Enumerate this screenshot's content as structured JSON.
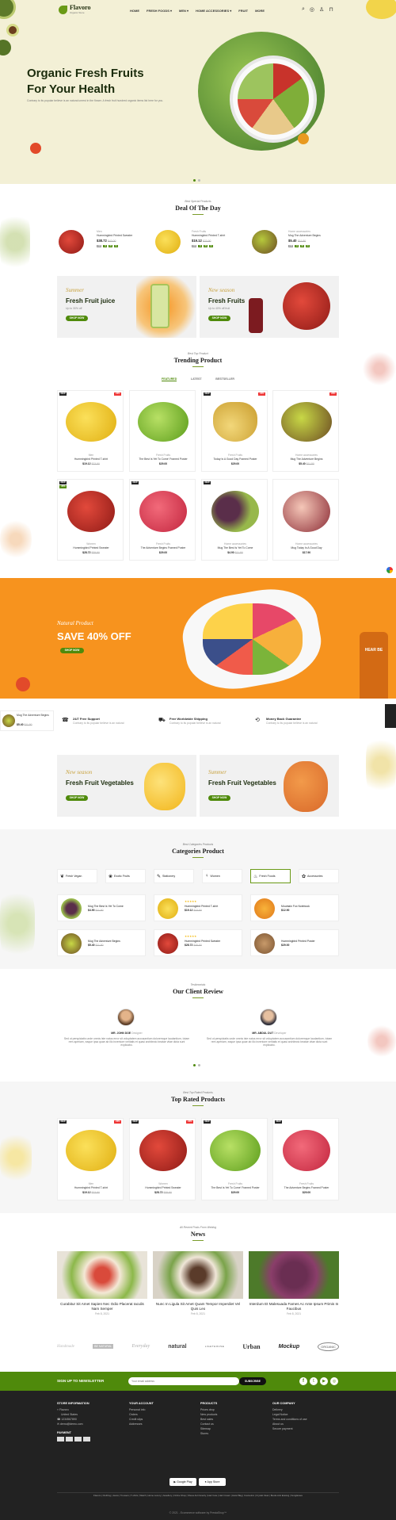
{
  "header": {
    "brand": "Flavoro",
    "brand_tagline": "Organic Store",
    "nav": [
      "HOME",
      "FRESH FOODS",
      "MEN",
      "HOME ACCESSORIES",
      "FRUIT",
      "MORE"
    ]
  },
  "hero": {
    "title_line1": "Organic Fresh Fruits",
    "title_line2": "For Your Health",
    "text": "Contrary to its popular believe is an natural unrest in the flower. A fresh fruit hundred organic items list here for you."
  },
  "deal": {
    "subtitle": "Best Special Products",
    "title": "Deal Of The Day",
    "items": [
      {
        "cat": "Men",
        "name": "Hummingbird Printed Sweater",
        "price": "$38.72",
        "old": "$43.00",
        "timer": [
          "249",
          "12",
          "05",
          "01"
        ]
      },
      {
        "cat": "Fresh Fruits",
        "name": "Hummingbird Printed T-shirt",
        "price": "$19.12",
        "old": "$23.90",
        "timer": [
          "249",
          "12",
          "05",
          "01"
        ]
      },
      {
        "cat": "Home accessories",
        "name": "Mug The Adventure Begins",
        "price": "$5.40",
        "old": "$11.90",
        "timer": [
          "249",
          "12",
          "05",
          "01"
        ]
      }
    ]
  },
  "promo1": [
    {
      "script": "Summer",
      "title": "Fresh Fruit juice",
      "text": "Up to 30% off",
      "btn": "SHOP NOW"
    },
    {
      "script": "New season",
      "title": "Fresh Fruits",
      "text": "Up to 40% off fruit",
      "btn": "SHOP NOW"
    }
  ],
  "trending": {
    "subtitle": "Best Top Product",
    "title": "Trending Product",
    "tabs": [
      "FEATURED",
      "LATEST",
      "BESTSELLER"
    ],
    "products": [
      {
        "cat": "Men",
        "name": "Hummingbird Printed T-shirt",
        "price": "$19.12",
        "old": "$23.90",
        "badge": "NEW",
        "sale": "-20%",
        "fruit": "lemon"
      },
      {
        "cat": "Fresh Fruits",
        "name": "The Best Is Yet To Come' Framed Poster",
        "price": "$29.00",
        "old": "",
        "badge": "",
        "sale": "",
        "fruit": "lime"
      },
      {
        "cat": "Fresh Fruits",
        "name": "Today Is A Good Day Framed Poster",
        "price": "$29.00",
        "old": "",
        "badge": "NEW",
        "sale": "-20%",
        "fruit": "pineapple"
      },
      {
        "cat": "Home accessories",
        "name": "Mug The Adventure Begins",
        "price": "$5.40",
        "old": "$11.90",
        "badge": "",
        "sale": "-20%",
        "fruit": "kiwi"
      },
      {
        "cat": "Women",
        "name": "Hummingbird Printed Sweater",
        "price": "$28.72",
        "old": "$35.90",
        "badge": "NEW",
        "sale": "-20%",
        "fruit": "pomegranate"
      },
      {
        "cat": "Fresh Fruits",
        "name": "The Adventure Begins Framed Poster",
        "price": "$29.00",
        "old": "",
        "badge": "NEW",
        "sale": "",
        "fruit": "raspberry"
      },
      {
        "cat": "Home accessories",
        "name": "Mug The Best Is Yet To Come",
        "price": "$4.90",
        "old": "$11.90",
        "badge": "NEW",
        "sale": "",
        "fruit": "grapes"
      },
      {
        "cat": "Home accessories",
        "name": "Mug Today Is A Good Day",
        "price": "$17.90",
        "old": "",
        "badge": "",
        "sale": "",
        "fruit": "figs"
      }
    ]
  },
  "banner": {
    "script": "Natural Product",
    "title": "SAVE 40% OFF",
    "btn": "SHOP NOW",
    "bottle": "HEAR BE"
  },
  "mini": {
    "name": "Mug The Adventure Begins",
    "price": "$5.40",
    "old": "$11.90"
  },
  "services": [
    {
      "title": "24/7 Free Support",
      "text": "Contrary to its popular believe is an natural"
    },
    {
      "title": "Free Worldwide Shipping",
      "text": "Contrary to its popular believe is an natural"
    },
    {
      "title": "Money Back Guarantee",
      "text": "Contrary to its popular believe is an natural"
    }
  ],
  "promo2": [
    {
      "script": "New season",
      "title": "Fresh Fruit Vegetables",
      "btn": "SHOP NOW"
    },
    {
      "script": "Summer",
      "title": "Fresh Fruit Vegetables",
      "btn": "SHOP NOW"
    }
  ],
  "categories": {
    "subtitle": "Best Categories Products",
    "title": "Categories Product",
    "tabs": [
      "Fresh Vegan",
      "Exotic Fruits",
      "Stationery",
      "Women",
      "Fresh Foods",
      "Accessories"
    ],
    "items": [
      {
        "name": "Mug The Best Is Yet To Come",
        "price": "$4.90",
        "old": "$11.90",
        "fruit": "grapes"
      },
      {
        "name": "Hummingbird Printed T-shirt",
        "price": "$19.12",
        "old": "$23.90",
        "fruit": "lemon"
      },
      {
        "name": "Mountain Fox Notebook",
        "price": "$12.90",
        "old": "",
        "fruit": "orange"
      },
      {
        "name": "Mug The Adventure Begins",
        "price": "$5.40",
        "old": "$11.90",
        "fruit": "kiwi"
      },
      {
        "name": "Hummingbird Printed Sweater",
        "price": "$28.72",
        "old": "$35.90",
        "fruit": "pomegranate"
      },
      {
        "name": "Hummingbird Printed Poster",
        "price": "$29.00",
        "old": "",
        "fruit": "walnut"
      }
    ]
  },
  "reviews": {
    "subtitle": "Testimonials",
    "title": "Our Client Review",
    "items": [
      {
        "name": "MR. JOHN DOE",
        "role": "Designer",
        "text": "Sed ut perspiciatis unde omnis iste natus error sit voluptatem accusantium doloremque laudantium, totam rem aperiam, eaque ipsa quae ab illo inventore veritatis et quasi architecto beatae vitae dicta sunt explicabo."
      },
      {
        "name": "MR. ABDUL DUT",
        "role": "Developer",
        "text": "Sed ut perspiciatis unde omnis iste natus error sit voluptatem accusantium doloremque laudantium, totam rem aperiam, eaque ipsa quae ab illo inventore veritatis et quasi architecto beatae vitae dicta sunt explicabo."
      }
    ]
  },
  "toprated": {
    "subtitle": "Best Top Rated Products",
    "title": "Top Rated Products",
    "products": [
      {
        "cat": "Men",
        "name": "Hummingbird Printed T-shirt",
        "price": "$19.12",
        "old": "$23.90",
        "badge": "NEW",
        "sale": "-20%",
        "fruit": "lemon"
      },
      {
        "cat": "Women",
        "name": "Hummingbird Printed Sweater",
        "price": "$28.72",
        "old": "$35.90",
        "badge": "NEW",
        "sale": "-20%",
        "fruit": "pomegranate"
      },
      {
        "cat": "Fresh Fruits",
        "name": "The Best Is Yet To Come' Framed Poster",
        "price": "$29.00",
        "old": "",
        "badge": "NEW",
        "sale": "",
        "fruit": "lime"
      },
      {
        "cat": "Fresh Fruits",
        "name": "The Adventure Begins Framed Poster",
        "price": "$29.00",
        "old": "",
        "badge": "NEW",
        "sale": "",
        "fruit": "raspberry"
      }
    ]
  },
  "news": {
    "subtitle": "All Recent Posts From Weblog",
    "title": "News",
    "items": [
      {
        "title": "Curabitur Sit Amet Sapien Nec Odio Placerat Iaculis Nam Semper",
        "date": "Feb 8, 2021"
      },
      {
        "title": "Nunc In Ligula Sit Amet Quam Tempor Imperdiet Vel Quis Leo",
        "date": "Feb 8, 2021"
      },
      {
        "title": "Interdum Et Malesuada Fames Ac Ante Ipsum Primis In Faucibus",
        "date": "Feb 8, 2021"
      }
    ]
  },
  "brands": [
    "Handmade",
    "BE NATURAL",
    "Everyday",
    "natural",
    "LIGHTHOUSE",
    "Urban",
    "Mockup",
    "ORGANIC"
  ],
  "newsletter": {
    "label": "SIGN UP TO NEWSLETTER",
    "placeholder": "Your email address",
    "btn": "SUBSCRIBE"
  },
  "footer": {
    "cols": [
      {
        "title": "STORE INFORMATION",
        "items": [
          "Flavoro",
          "United States",
          "1234567890",
          "demo@demo.com"
        ]
      },
      {
        "title": "YOUR ACCOUNT",
        "items": [
          "Personal info",
          "Orders",
          "Credit slips",
          "Addresses"
        ]
      },
      {
        "title": "PRODUCTS",
        "items": [
          "Prices drop",
          "New products",
          "Best sales",
          "Contact us",
          "Sitemap",
          "Stores"
        ]
      },
      {
        "title": "OUR COMPANY",
        "items": [
          "Delivery",
          "Legal Notice",
          "Terms and conditions of use",
          "About us",
          "Secure payment"
        ]
      }
    ],
    "payment_label": "PAYMENT",
    "apps": [
      "Google Play",
      "App Store"
    ],
    "tags": "Flavoro | Clothing | Jeans | Trousers | T-shirts | Watch | Home Luxury | Jewellery | Online Shop | Shoes Anti Gravity | Hair Care | Hair Cream | Hand Bag | Cosmetics | Crystal Clear | Books Anti Erasing | Sunglasses",
    "copyright": "© 2021 - Ecommerce software by PrestaShop™"
  }
}
